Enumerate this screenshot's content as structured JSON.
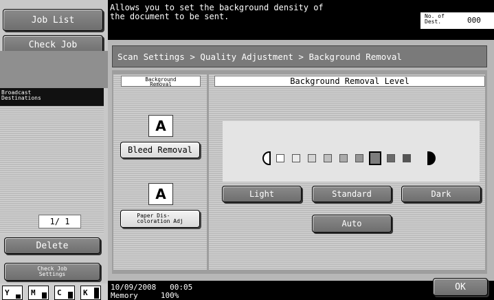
{
  "sidebar": {
    "job_list_label": "Job List",
    "check_job_label": "Check Job",
    "broadcast_title": "Broadcast\nDestinations",
    "pager": "1/ 1",
    "delete_label": "Delete",
    "check_job_settings_label": "Check Job\nSettings",
    "toner": [
      {
        "name": "Y",
        "level": 0.35
      },
      {
        "name": "M",
        "level": 0.55
      },
      {
        "name": "C",
        "level": 0.6
      },
      {
        "name": "K",
        "level": 0.95
      }
    ]
  },
  "message": {
    "text_line1": "Allows you to set the background density of",
    "text_line2": "the document to be sent.",
    "counter_label": "No. of\nDest.",
    "counter_value": "000"
  },
  "breadcrumb": "Scan Settings > Quality Adjustment > Background Removal",
  "left_panel": {
    "header": "Background\nRemoval",
    "options": [
      {
        "icon": "A",
        "label": "Bleed Removal"
      },
      {
        "icon": "A",
        "label": "Paper Dis-\ncoloration Adj"
      }
    ]
  },
  "right_panel": {
    "header": "Background Removal Level",
    "level_count": 9,
    "selected_level": 7,
    "buttons": {
      "light": "Light",
      "standard": "Standard",
      "dark": "Dark",
      "auto": "Auto"
    }
  },
  "status": {
    "datetime": "10/09/2008   00:05",
    "memory_label": "Memory",
    "memory_value": "100%",
    "ok_label": "OK"
  },
  "colors": {
    "dark_button": "#7a7a7a",
    "panel_bg": "#b7b7b7",
    "selected_square": "#7d7d7d"
  }
}
